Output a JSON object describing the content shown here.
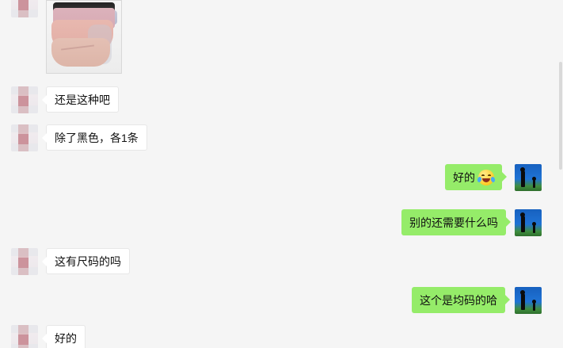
{
  "messages": [
    {
      "side": "incoming",
      "text": "还是这种吧"
    },
    {
      "side": "incoming",
      "text": "除了黑色，各1条"
    },
    {
      "side": "outgoing",
      "text": "好的"
    },
    {
      "side": "outgoing",
      "text": "别的还需要什么吗"
    },
    {
      "side": "incoming",
      "text": "这有尺码的吗"
    },
    {
      "side": "outgoing",
      "text": "这个是均码的哈"
    },
    {
      "side": "incoming",
      "text": "好的"
    }
  ],
  "icons": {
    "emoji": "laughing-tears-emoji-icon"
  },
  "colors": {
    "background": "#f5f5f5",
    "incoming_bubble": "#ffffff",
    "outgoing_bubble": "#95ec69"
  }
}
